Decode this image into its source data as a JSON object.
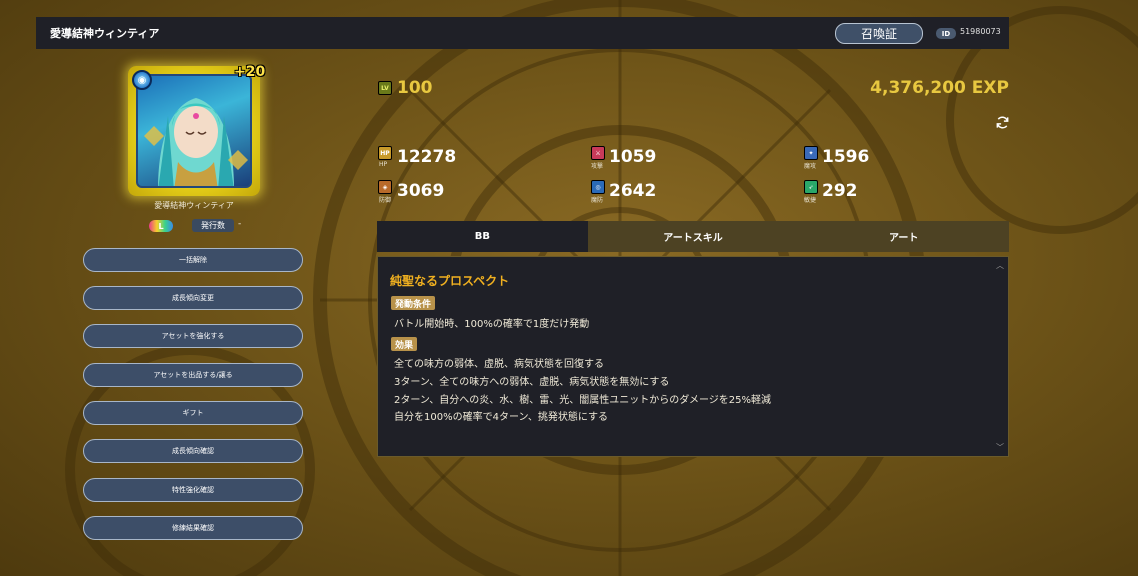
{
  "header": {
    "title": "愛導結神ウィンティア",
    "summon_button": "召喚証",
    "id_label": "ID",
    "id_value": "51980073"
  },
  "card": {
    "plus": "+20",
    "element_icon": "water-element-icon"
  },
  "unit": {
    "name": "愛導結神ウィンティア",
    "rarity": "L",
    "issued_label": "発行数",
    "issued_value": "-"
  },
  "menu": [
    {
      "label": "一括解除"
    },
    {
      "label": "成長傾向変更"
    },
    {
      "label": "アセットを強化する"
    },
    {
      "label": "アセットを出品する/譲る"
    },
    {
      "label": "ギフト"
    },
    {
      "label": "成長傾向確認"
    },
    {
      "label": "特性強化確認"
    },
    {
      "label": "修練結果確認"
    }
  ],
  "level": {
    "icon_text": "LV",
    "value": "100",
    "exp": "4,376,200 EXP"
  },
  "stats": {
    "hp": {
      "label": "HP",
      "value": "12278",
      "color": "#c89a2a"
    },
    "atk": {
      "label": "攻撃",
      "value": "1059",
      "color": "#c83a5a"
    },
    "matk": {
      "label": "魔攻",
      "value": "1596",
      "color": "#3a6ab8"
    },
    "def": {
      "label": "防御",
      "value": "3069",
      "color": "#b86a2a"
    },
    "mdef": {
      "label": "魔防",
      "value": "2642",
      "color": "#2a6ab8"
    },
    "agi": {
      "label": "敏捷",
      "value": "292",
      "color": "#2aa86a"
    }
  },
  "tabs": [
    {
      "label": "BB",
      "active": true
    },
    {
      "label": "アートスキル",
      "active": false
    },
    {
      "label": "アート",
      "active": false
    }
  ],
  "skill": {
    "name": "純聖なるプロスペクト",
    "condition_label": "発動条件",
    "condition_text": "バトル開始時、100%の確率で1度だけ発動",
    "effect_label": "効果",
    "effects": [
      "全ての味方の弱体、虚脱、病気状態を回復する",
      "3ターン、全ての味方への弱体、虚脱、病気状態を無効にする",
      "2ターン、自分への炎、水、樹、雷、光、闇属性ユニットからのダメージを25%軽減",
      "自分を100%の確率で4ターン、挑発状態にする"
    ]
  },
  "colors": {
    "accent_gold": "#e8c840",
    "panel_bg": "#1f2027",
    "tag_bg": "#b8924a"
  }
}
